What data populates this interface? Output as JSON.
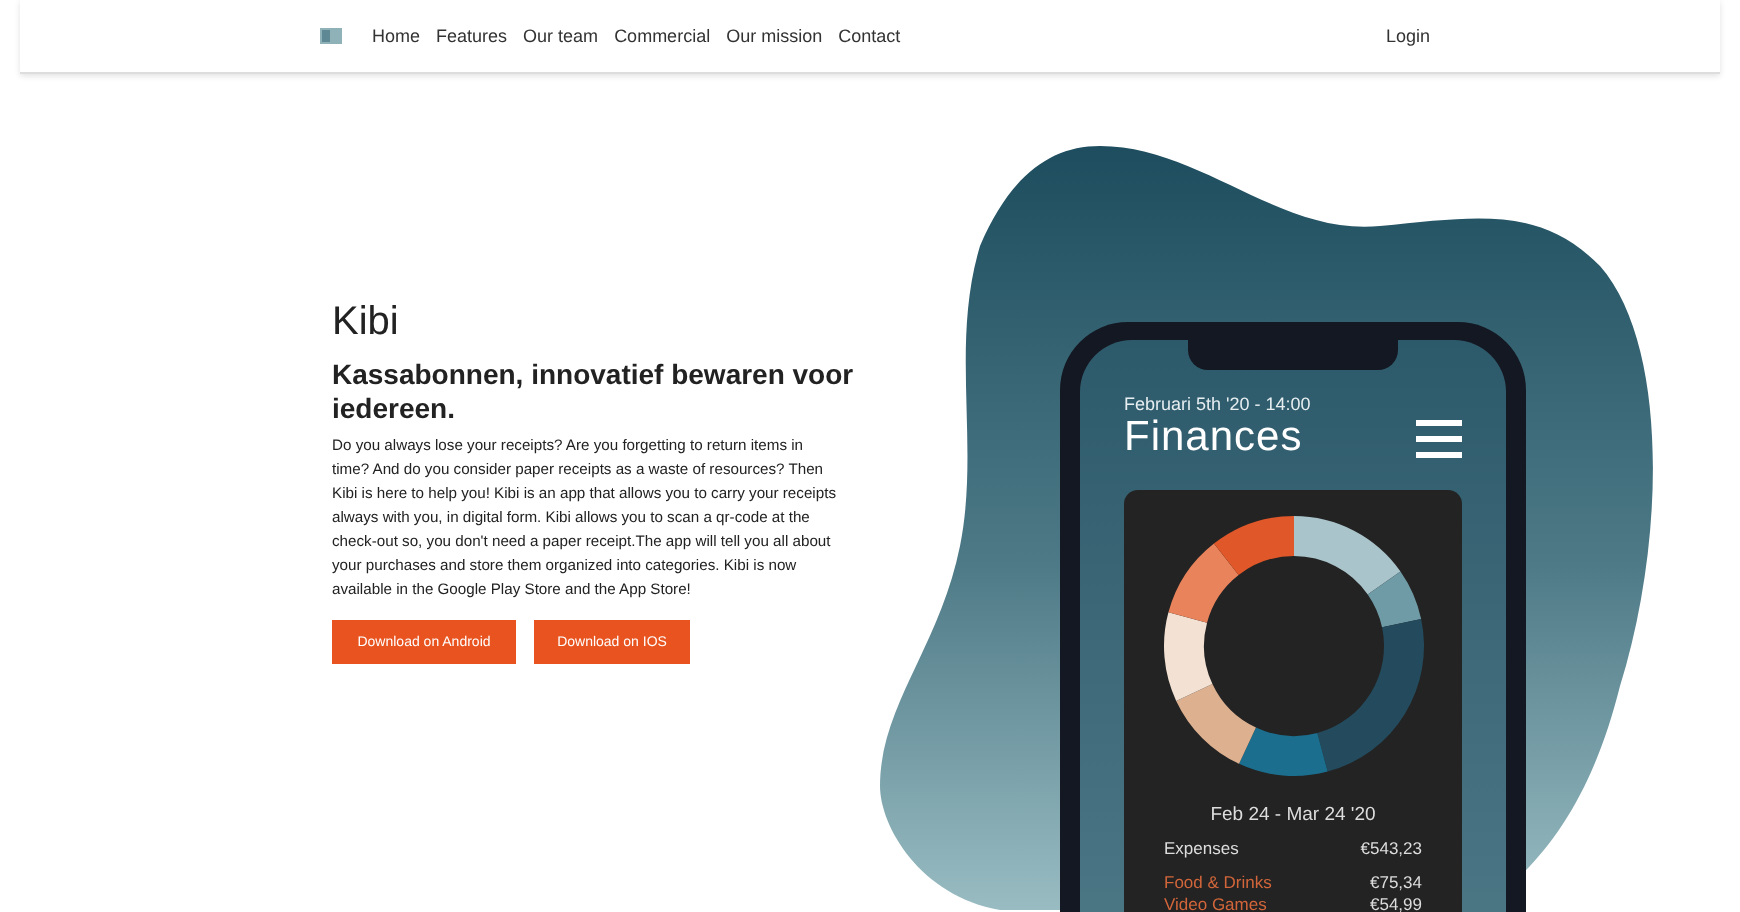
{
  "nav": {
    "links": [
      "Home",
      "Features",
      "Our team",
      "Commercial",
      "Our mission",
      "Contact"
    ],
    "login": "Login"
  },
  "hero": {
    "title": "Kibi",
    "subtitle": "Kassabonnen, innovatief bewaren voor iedereen.",
    "text": "Do you always lose your receipts? Are you forgetting to return items in time? And do you consider paper receipts as a waste of resources? Then Kibi is here to help you! Kibi is an app that allows you to carry your receipts always with you, in digital form. Kibi allows you to scan a qr-code at the check-out so, you don't need a paper receipt.The app will tell you all about your purchases and store them organized into categories. Kibi is now available in the Google Play Store and the App Store!",
    "buttons": [
      "Download on Android",
      "Download on IOS"
    ]
  },
  "phone": {
    "datetime": "Februari 5th '20 - 14:00",
    "title": "Finances",
    "period": "Feb 24 - Mar 24 '20",
    "total": {
      "label": "Expenses",
      "amount": "€543,23"
    },
    "categories": [
      {
        "label": "Food & Drinks",
        "amount": "€75,34"
      },
      {
        "label": "Video Games",
        "amount": "€54,99"
      }
    ]
  }
}
